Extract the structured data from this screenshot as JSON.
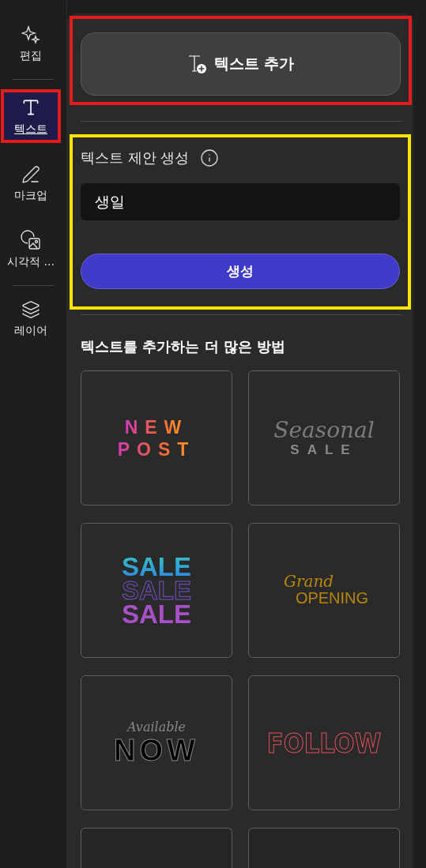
{
  "sidebar": {
    "groups": [
      {
        "items": [
          {
            "label": "편집",
            "kind": "sparkle",
            "selected": false
          }
        ]
      },
      {
        "items": [
          {
            "label": "텍스트",
            "kind": "text",
            "selected": true
          },
          {
            "label": "마크업",
            "kind": "pen",
            "selected": false
          },
          {
            "label": "시각적 ...",
            "kind": "shapes",
            "selected": false
          }
        ]
      },
      {
        "items": [
          {
            "label": "레이어",
            "kind": "layers",
            "selected": false
          }
        ]
      }
    ]
  },
  "add_text_button": {
    "label": "텍스트 추가"
  },
  "suggestions": {
    "title": "텍스트 제안 생성",
    "input_value": "생일",
    "generate_button": "생성"
  },
  "more_ways": {
    "heading": "텍스트를 추가하는 더 많은 방법",
    "templates": [
      {
        "lines": [
          {
            "text": "NEW",
            "kind": "spaced-gradient"
          },
          {
            "text": "POST",
            "kind": "spaced-gradient"
          }
        ]
      },
      {
        "lines": [
          {
            "text": "Seasonal",
            "kind": "script-grey"
          },
          {
            "text": "SALE",
            "kind": "spaced-grey"
          }
        ]
      },
      {
        "lines": [
          {
            "text": "SALE",
            "kind": "bold-teal"
          },
          {
            "text": "SALE",
            "kind": "outline-purple"
          },
          {
            "text": "SALE",
            "kind": "bold-purple"
          }
        ]
      },
      {
        "lines": [
          {
            "text": "Grand",
            "kind": "script-gold"
          },
          {
            "text": "OPENING",
            "kind": "thin-gold"
          }
        ]
      },
      {
        "lines": [
          {
            "text": "Available",
            "kind": "script-italic-grey"
          },
          {
            "text": "NOW",
            "kind": "outline-black"
          }
        ]
      },
      {
        "lines": [
          {
            "text": "FOLLOW",
            "kind": "outline-red"
          }
        ]
      },
      {
        "kind": "blank"
      },
      {
        "kind": "blank"
      }
    ]
  }
}
